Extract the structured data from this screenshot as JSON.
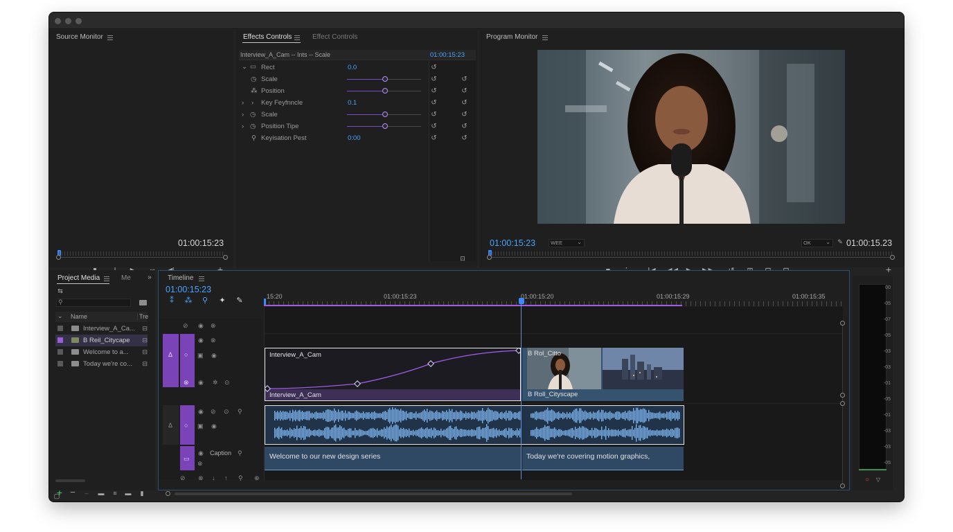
{
  "source_monitor": {
    "title": "Source Monitor",
    "timecode": "01:00:15:23"
  },
  "effects_controls": {
    "tabs": [
      "Effects Controls",
      "Effect Controls"
    ],
    "clip_path": "Interview_A_Cam -- Ints -- Scale",
    "timecode": "01:00:15:23",
    "rows": [
      {
        "label": "Rect",
        "value": "0.0"
      },
      {
        "label": "Scale",
        "value": ""
      },
      {
        "label": "Position",
        "value": ""
      },
      {
        "label": "Key Feyfnncle",
        "value": "0.1"
      },
      {
        "label": "Scale",
        "value": ""
      },
      {
        "label": "Position Tipe",
        "value": ""
      },
      {
        "label": "Keyisation Pest",
        "value": "0:00"
      }
    ]
  },
  "program_monitor": {
    "title": "Program Monitor",
    "timecode_left": "01:00:15:23",
    "fit_select": "WEE",
    "quality_select": "OK",
    "timecode_right": "01:00:15.23"
  },
  "project": {
    "tabs": [
      "Project Media",
      "Me"
    ],
    "columns": [
      "Name",
      "Tre"
    ],
    "items": [
      {
        "name": "Interview_A_Ca..."
      },
      {
        "name": "B Reil_Citycape"
      },
      {
        "name": "Welcome to a..."
      },
      {
        "name": "Today we're co..."
      }
    ]
  },
  "timeline": {
    "title": "Timeline",
    "timecode": "01:00:15:23",
    "ruler": [
      "15:20",
      "01:00:15:23",
      "01:00:15:20",
      "01:00:15:29",
      "01:00:15:35"
    ],
    "caption_track_label": "Caption",
    "clips": {
      "v2_name": "Interview_A_Cam",
      "v1_name": "Interview_A_Cam",
      "broll_top": "B Rol_Citto",
      "broll_bottom": "B Roll_Cityscape",
      "caption_1": "Welcome to our new design series",
      "caption_2": "Today we're covering motion graphics,"
    }
  },
  "meter": {
    "scale": [
      "00",
      "-05",
      "-07",
      "-05",
      "-03",
      "-03",
      "-01",
      "-05",
      "-01",
      "-03",
      "-03",
      "-05"
    ]
  },
  "colors": {
    "accent_blue": "#4aa3ff",
    "purple": "#7b43b8",
    "clip_blue": "#35536f"
  }
}
